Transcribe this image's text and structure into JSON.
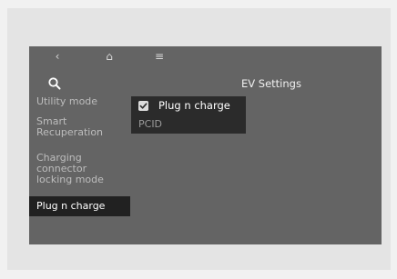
{
  "topbar": {
    "back_icon": "‹",
    "home_icon": "⌂",
    "menu_icon": "≡"
  },
  "header": {
    "title": "EV Settings"
  },
  "sidebar": {
    "items": [
      {
        "label": "Utility mode"
      },
      {
        "label": "Smart Recuperation"
      },
      {
        "label": "Charging connector locking mode"
      },
      {
        "label": "Plug n charge",
        "selected": true
      }
    ]
  },
  "panel": {
    "checkbox_label": "Plug n charge",
    "checkbox_checked": true,
    "pcid_label": "PCID"
  },
  "colors": {
    "screen_bg": "#646464",
    "selected_bg": "#212121",
    "panel_bg": "#2b2b2b"
  }
}
